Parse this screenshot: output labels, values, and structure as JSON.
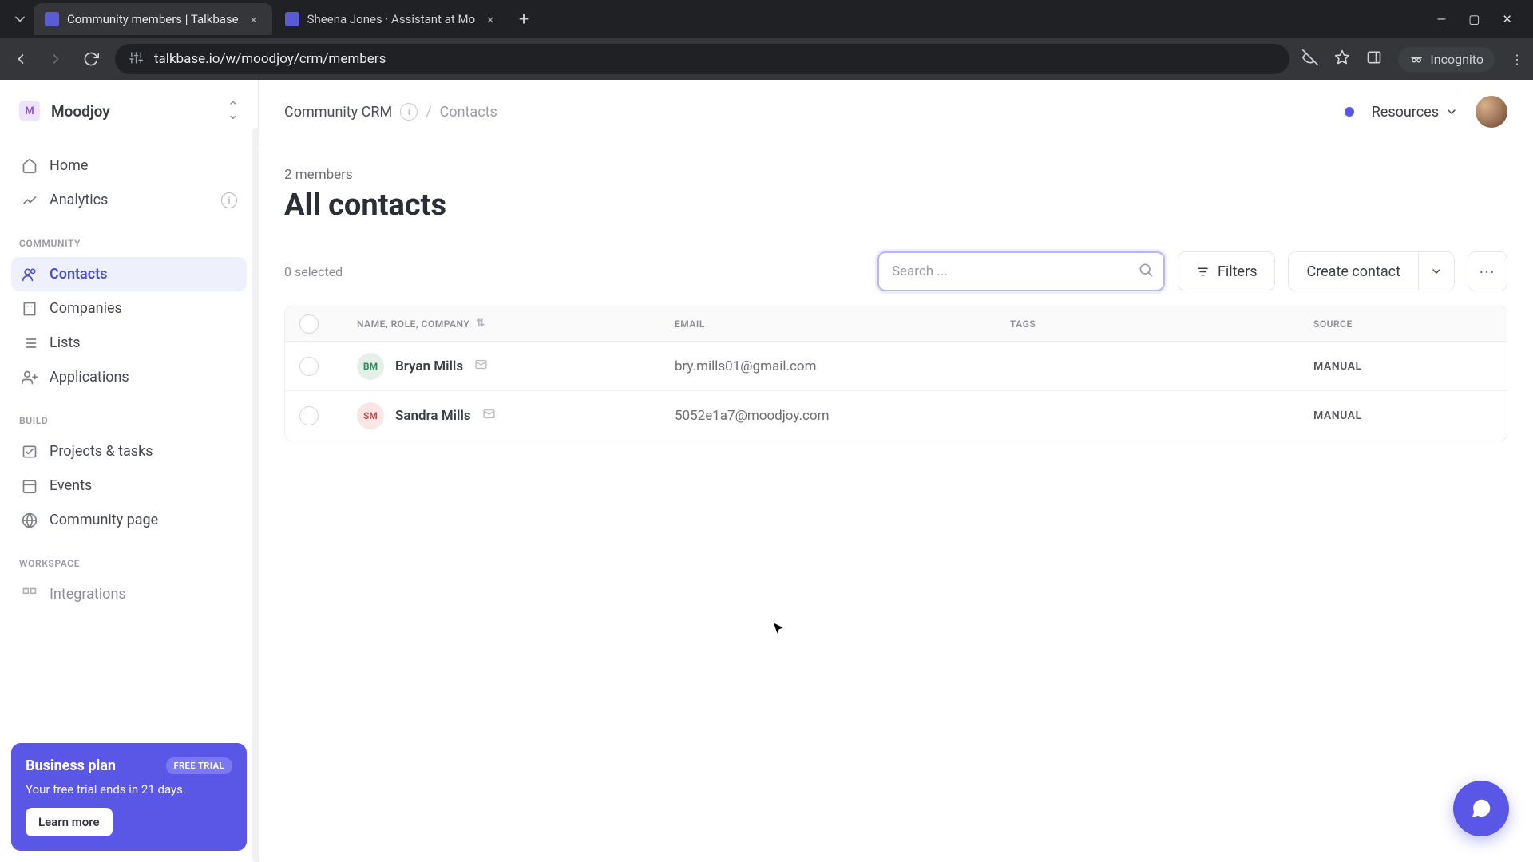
{
  "browser": {
    "tabs": [
      {
        "title": "Community members | Talkbase",
        "active": true
      },
      {
        "title": "Sheena Jones · Assistant at Mo",
        "active": false
      }
    ],
    "url": "talkbase.io/w/moodjoy/crm/members",
    "incognito_label": "Incognito"
  },
  "workspace": {
    "initial": "M",
    "name": "Moodjoy"
  },
  "sidebar": {
    "section_community": "COMMUNITY",
    "section_build": "BUILD",
    "section_workspace": "WORKSPACE",
    "home": "Home",
    "analytics": "Analytics",
    "contacts": "Contacts",
    "companies": "Companies",
    "lists": "Lists",
    "applications": "Applications",
    "projects": "Projects & tasks",
    "events": "Events",
    "community_page": "Community page",
    "integrations": "Integrations"
  },
  "trial": {
    "title": "Business plan",
    "badge": "FREE TRIAL",
    "subtitle": "Your free trial ends in 21 days.",
    "cta": "Learn more"
  },
  "breadcrumb": {
    "root": "Community CRM",
    "current": "Contacts"
  },
  "header": {
    "resources": "Resources"
  },
  "page": {
    "member_count": "2 members",
    "title": "All contacts",
    "selected": "0 selected"
  },
  "toolbar": {
    "search_placeholder": "Search ...",
    "filters": "Filters",
    "create": "Create contact"
  },
  "table": {
    "cols": {
      "name": "NAME, ROLE, COMPANY",
      "email": "EMAIL",
      "tags": "TAGS",
      "source": "SOURCE"
    },
    "rows": [
      {
        "initials": "BM",
        "avatar_class": "av-bm",
        "name": "Bryan Mills",
        "email": "bry.mills01@gmail.com",
        "source": "MANUAL"
      },
      {
        "initials": "SM",
        "avatar_class": "av-sm",
        "name": "Sandra Mills",
        "email": "5052e1a7@moodjoy.com",
        "source": "MANUAL"
      }
    ]
  }
}
